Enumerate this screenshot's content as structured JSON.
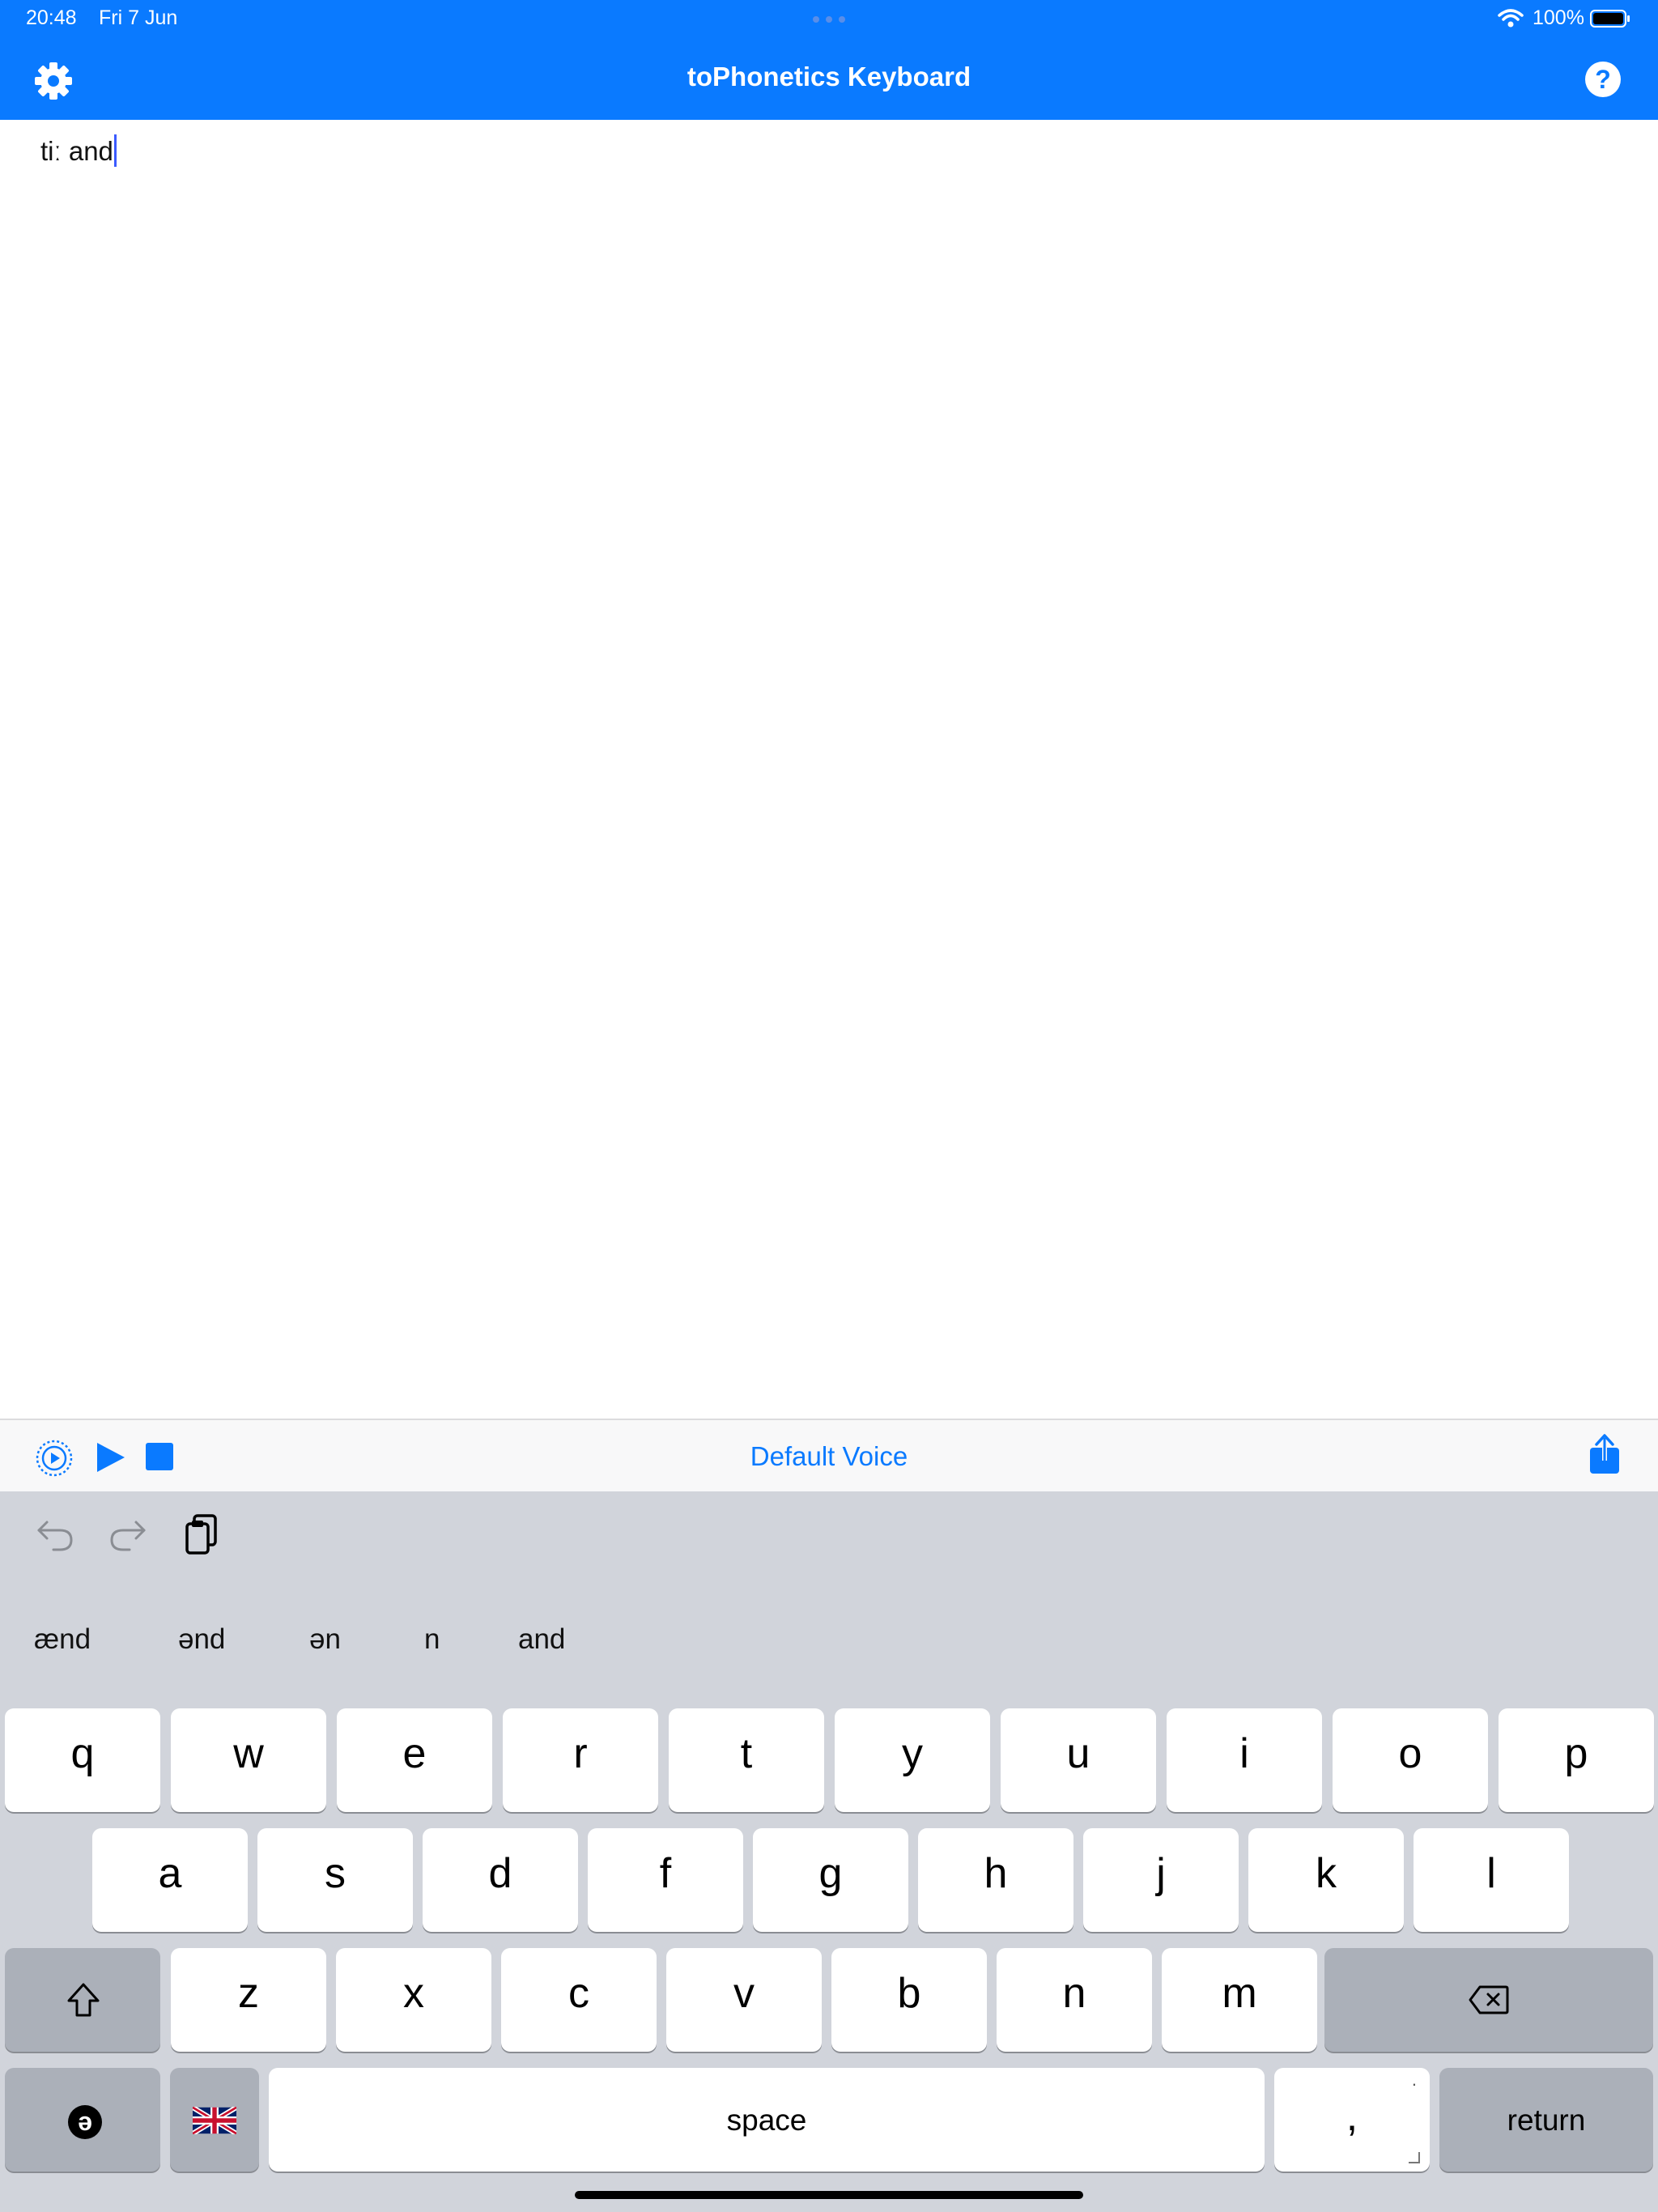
{
  "status_bar": {
    "time": "20:48",
    "date": "Fri 7 Jun",
    "battery": "100%"
  },
  "nav": {
    "title": "toPhonetics Keyboard",
    "help_label": "?"
  },
  "editor": {
    "text": "tiː and"
  },
  "playbar": {
    "voice_label": "Default Voice"
  },
  "keyboard": {
    "suggestions": [
      "ænd",
      "ənd",
      "ən",
      "n",
      "and"
    ],
    "row1": [
      "q",
      "w",
      "e",
      "r",
      "t",
      "y",
      "u",
      "i",
      "o",
      "p"
    ],
    "row2": [
      "a",
      "s",
      "d",
      "f",
      "g",
      "h",
      "j",
      "k",
      "l"
    ],
    "row3": [
      "z",
      "x",
      "c",
      "v",
      "b",
      "n",
      "m"
    ],
    "space_label": "space",
    "comma_label": ",",
    "comma_alt": ".",
    "return_label": "return",
    "schwa_label": "ə"
  },
  "colors": {
    "accent": "#0a7aff",
    "keyboard_bg": "#d1d4db",
    "dark_key": "#abb0b9"
  },
  "icons": [
    "settings-gear-icon",
    "help-icon",
    "wifi-icon",
    "battery-icon",
    "speak-selection-icon",
    "play-icon",
    "stop-icon",
    "share-icon",
    "undo-icon",
    "redo-icon",
    "paste-icon",
    "shift-icon",
    "delete-icon",
    "schwa-icon",
    "uk-flag-icon"
  ]
}
